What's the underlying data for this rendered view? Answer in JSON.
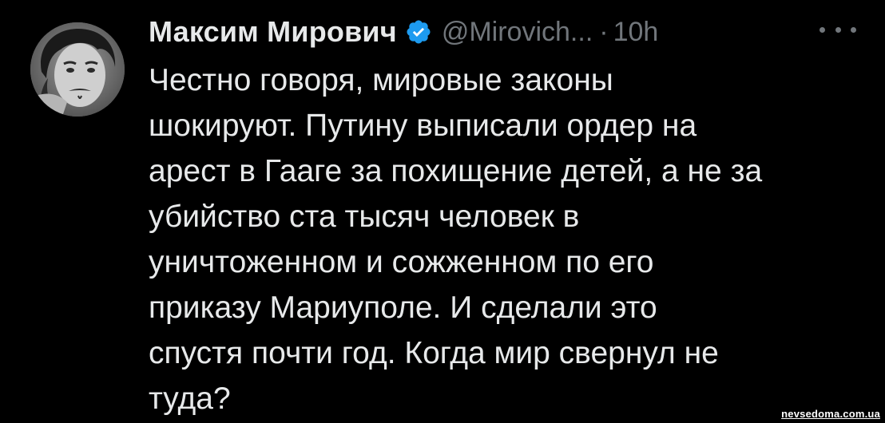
{
  "tweet": {
    "author": {
      "display_name": "Максим Мирович",
      "handle": "@Mirovich...",
      "verified": true,
      "verified_icon": "verified-badge-icon",
      "avatar_icon": "avatar-photo"
    },
    "separator": "·",
    "time": "10h",
    "more_icon": "more-options-icon",
    "text_lines": [
      "Честно говоря, мировые законы",
      "шокируют. Путину выписали ордер на",
      "арест в Гааге за похищение детей, а не за",
      "убийство ста тысяч человек в",
      "уничтоженном и сожженном по его",
      "приказу Мариуполе. И сделали это",
      "спустя почти год. Когда мир свернул не",
      "туда?"
    ]
  },
  "watermark": "nevsedoma.com.ua",
  "colors": {
    "background": "#000000",
    "text": "#e7e9ea",
    "secondary": "#71767b",
    "verified": "#1d9bf0"
  }
}
